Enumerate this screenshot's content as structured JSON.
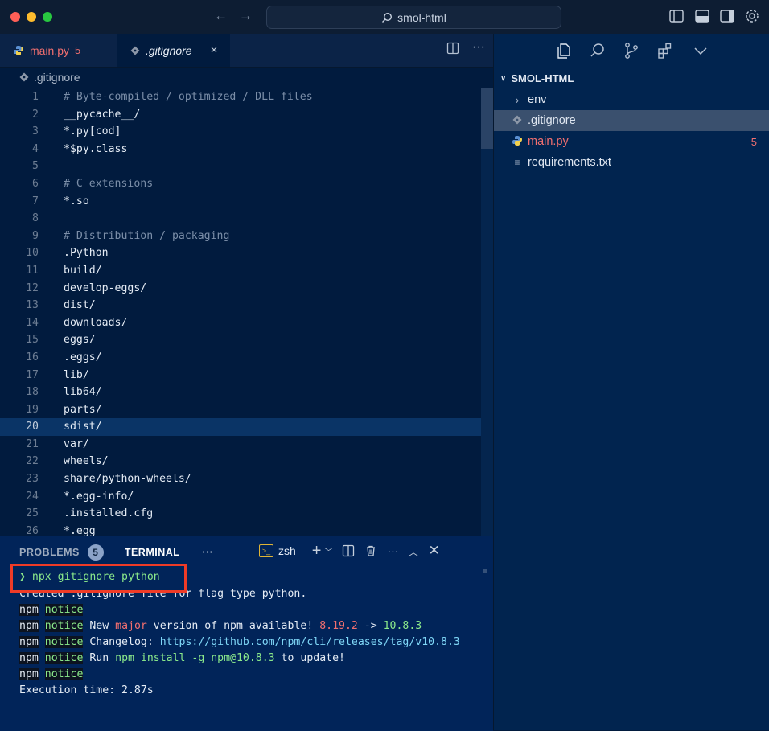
{
  "window": {
    "title": "smol-html",
    "colors": {
      "close": "#fe5f57",
      "minimize": "#febc2e",
      "zoom": "#28c840"
    }
  },
  "editor": {
    "tabs": [
      {
        "label": "main.py",
        "badge": "5",
        "icon": "python-icon"
      },
      {
        "label": ".gitignore",
        "icon": "git-diamond-icon",
        "close": "×",
        "active": true
      }
    ],
    "breadcrumb": ".gitignore",
    "active_line": "20",
    "lines": [
      {
        "n": "1",
        "t": "# Byte-compiled / optimized / DLL files",
        "c": true
      },
      {
        "n": "2",
        "t": "__pycache__/"
      },
      {
        "n": "3",
        "t": "*.py[cod]"
      },
      {
        "n": "4",
        "t": "*$py.class"
      },
      {
        "n": "5",
        "t": ""
      },
      {
        "n": "6",
        "t": "# C extensions",
        "c": true
      },
      {
        "n": "7",
        "t": "*.so"
      },
      {
        "n": "8",
        "t": ""
      },
      {
        "n": "9",
        "t": "# Distribution / packaging",
        "c": true
      },
      {
        "n": "10",
        "t": ".Python"
      },
      {
        "n": "11",
        "t": "build/"
      },
      {
        "n": "12",
        "t": "develop-eggs/"
      },
      {
        "n": "13",
        "t": "dist/"
      },
      {
        "n": "14",
        "t": "downloads/"
      },
      {
        "n": "15",
        "t": "eggs/"
      },
      {
        "n": "16",
        "t": ".eggs/"
      },
      {
        "n": "17",
        "t": "lib/"
      },
      {
        "n": "18",
        "t": "lib64/"
      },
      {
        "n": "19",
        "t": "parts/"
      },
      {
        "n": "20",
        "t": "sdist/"
      },
      {
        "n": "21",
        "t": "var/"
      },
      {
        "n": "22",
        "t": "wheels/"
      },
      {
        "n": "23",
        "t": "share/python-wheels/"
      },
      {
        "n": "24",
        "t": "*.egg-info/"
      },
      {
        "n": "25",
        "t": ".installed.cfg"
      },
      {
        "n": "26",
        "t": "*.egg"
      }
    ]
  },
  "panel": {
    "problems_label": "PROBLEMS",
    "problems_count": "5",
    "terminal_label": "TERMINAL",
    "more": "···",
    "shell": "zsh",
    "terminal": {
      "prompt": "❯",
      "command": "npx gitignore python",
      "created": "Created .gitignore file for flag type python.",
      "npm": "npm",
      "notice": "notice",
      "new_version_pre": " New ",
      "major": "major",
      "new_version_mid": " version of npm available! ",
      "old_ver": "8.19.2",
      "arrow": " -> ",
      "new_ver": "10.8.3",
      "changelog_pre": " Changelog: ",
      "changelog_url": "https://github.com/npm/cli/releases/tag/v10.8.3",
      "run_pre": " Run ",
      "run_cmd": "npm install -g npm@10.8.3",
      "run_post": " to update!",
      "exec_time": "Execution time: 2.87s"
    }
  },
  "explorer": {
    "title": "SMOL-HTML",
    "items": [
      {
        "label": "env",
        "icon": "chevron-right-icon"
      },
      {
        "label": ".gitignore",
        "icon": "git-diamond-icon",
        "selected": true
      },
      {
        "label": "main.py",
        "icon": "python-icon",
        "count": "5"
      },
      {
        "label": "requirements.txt",
        "icon": "text-lines-icon"
      }
    ]
  }
}
